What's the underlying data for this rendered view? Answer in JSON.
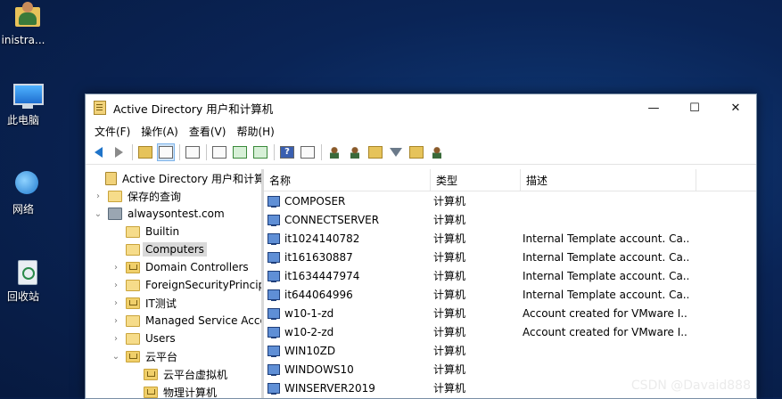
{
  "desktop": {
    "icons": [
      {
        "label": "inistra...",
        "icon": "user-folder-icon"
      },
      {
        "label": "此电脑",
        "icon": "this-pc-icon"
      },
      {
        "label": "网络",
        "icon": "network-icon"
      },
      {
        "label": "回收站",
        "icon": "recycle-bin-icon"
      }
    ]
  },
  "window": {
    "title": "Active Directory 用户和计算机",
    "controls": {
      "minimize": "—",
      "maximize": "☐",
      "close": "✕"
    }
  },
  "menubar": {
    "items": [
      "文件(F)",
      "操作(A)",
      "查看(V)",
      "帮助(H)"
    ]
  },
  "toolbar": {
    "icons": [
      "back-arrow-icon",
      "forward-arrow-icon",
      "up-folder-icon",
      "show-tree-icon",
      "clipboard-icon",
      "properties-icon",
      "refresh-icon",
      "export-list-icon",
      "help-icon",
      "console-icon",
      "new-user-icon",
      "new-group-icon",
      "new-ou-icon",
      "filter-icon",
      "find-icon",
      "add-to-group-icon"
    ]
  },
  "tree": {
    "items": [
      {
        "label": "Active Directory 用户和计算机",
        "level": 0,
        "twisty": "",
        "icon": "root"
      },
      {
        "label": "保存的查询",
        "level": 1,
        "twisty": "›",
        "icon": "plain"
      },
      {
        "label": "alwaysontest.com",
        "level": 1,
        "twisty": "⌄",
        "icon": "dom"
      },
      {
        "label": "Builtin",
        "level": 2,
        "twisty": "",
        "icon": "plain"
      },
      {
        "label": "Computers",
        "level": 2,
        "twisty": "",
        "icon": "plain",
        "selected": true
      },
      {
        "label": "Domain Controllers",
        "level": 2,
        "twisty": "›",
        "icon": "ou"
      },
      {
        "label": "ForeignSecurityPrincipals",
        "level": 2,
        "twisty": "›",
        "icon": "plain"
      },
      {
        "label": "IT测试",
        "level": 2,
        "twisty": "›",
        "icon": "ou"
      },
      {
        "label": "Managed Service Accounts",
        "level": 2,
        "twisty": "›",
        "icon": "plain"
      },
      {
        "label": "Users",
        "level": 2,
        "twisty": "›",
        "icon": "plain"
      },
      {
        "label": "云平台",
        "level": 2,
        "twisty": "⌄",
        "icon": "ou"
      },
      {
        "label": "云平台虚拟机",
        "level": 3,
        "twisty": "",
        "icon": "ou"
      },
      {
        "label": "物理计算机",
        "level": 3,
        "twisty": "",
        "icon": "ou"
      }
    ]
  },
  "list": {
    "columns": [
      "名称",
      "类型",
      "描述"
    ],
    "rows": [
      {
        "name": "COMPOSER",
        "type": "计算机",
        "desc": ""
      },
      {
        "name": "CONNECTSERVER",
        "type": "计算机",
        "desc": ""
      },
      {
        "name": "it1024140782",
        "type": "计算机",
        "desc": "Internal Template account. Ca..."
      },
      {
        "name": "it161630887",
        "type": "计算机",
        "desc": "Internal Template account. Ca..."
      },
      {
        "name": "it1634447974",
        "type": "计算机",
        "desc": "Internal Template account. Ca..."
      },
      {
        "name": "it644064996",
        "type": "计算机",
        "desc": "Internal Template account. Ca..."
      },
      {
        "name": "w10-1-zd",
        "type": "计算机",
        "desc": "Account created for VMware I..."
      },
      {
        "name": "w10-2-zd",
        "type": "计算机",
        "desc": "Account created for VMware I..."
      },
      {
        "name": "WIN10ZD",
        "type": "计算机",
        "desc": ""
      },
      {
        "name": "WINDOWS10",
        "type": "计算机",
        "desc": ""
      },
      {
        "name": "WINSERVER2019",
        "type": "计算机",
        "desc": ""
      }
    ]
  },
  "watermark": "CSDN @Davaid888"
}
